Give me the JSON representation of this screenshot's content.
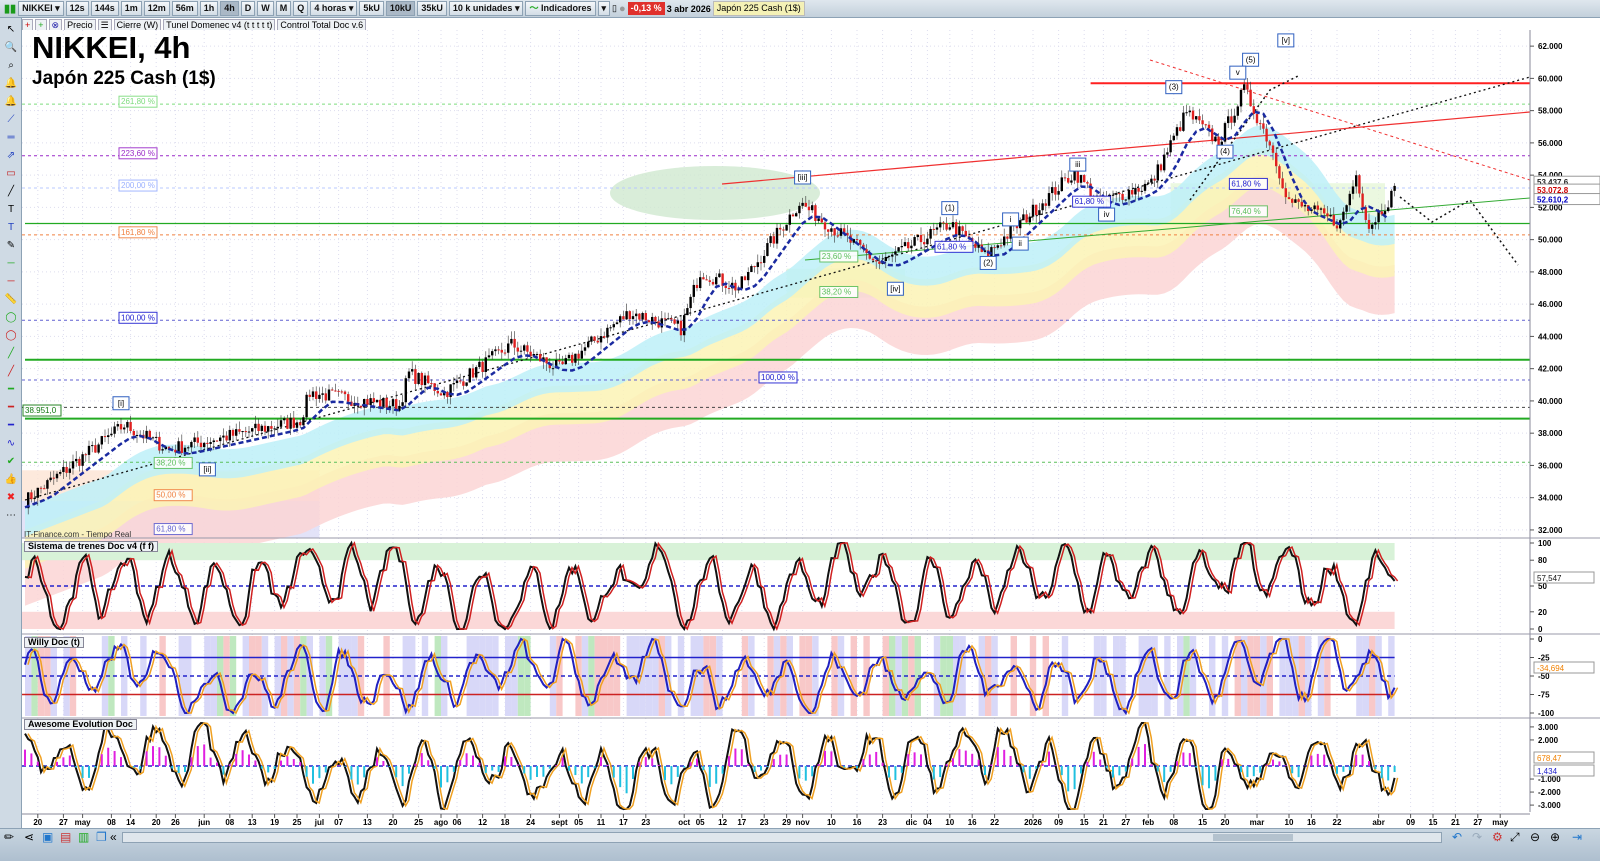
{
  "toolbar": {
    "symbol": "NIKKEI",
    "intervals": [
      "12s",
      "144s",
      "1m",
      "12m",
      "56m",
      "1h",
      "4h",
      "D",
      "W",
      "M",
      "Q"
    ],
    "active_interval": "4h",
    "period": "4 horas",
    "units": [
      "5kU",
      "10kU",
      "35kU"
    ],
    "active_unit": "10kU",
    "units_select": "10 k unidades",
    "indicators": "Indicadores",
    "change": "-0,13 %",
    "date": "3 abr 2026",
    "instrument": "Japón 225 Cash (1$)"
  },
  "legend": {
    "items": [
      "Precio",
      "Cierre (W)",
      "Tunel Domenec v4 (t t t t t)",
      "Control Total Doc v.6"
    ]
  },
  "chart": {
    "title": "NIKKEI, 4h",
    "subtitle": "Japón 225 Cash (1$)",
    "source": "IT-Finance.com - Tiempo Real"
  },
  "colors": {
    "up": "#1aa81a",
    "down": "#e02020",
    "fib_red": "#ff2020",
    "support_green": "#22aa22"
  },
  "chart_data": {
    "type": "candlestick",
    "price_anchors": [
      [
        0,
        33800
      ],
      [
        31,
        38500
      ],
      [
        45,
        37000
      ],
      [
        86,
        38800
      ],
      [
        89,
        40500
      ],
      [
        117,
        39700
      ],
      [
        120,
        41700
      ],
      [
        131,
        40500
      ],
      [
        152,
        43500
      ],
      [
        167,
        42000
      ],
      [
        189,
        45500
      ],
      [
        205,
        44500
      ],
      [
        211,
        48000
      ],
      [
        223,
        47000
      ],
      [
        242,
        52300
      ],
      [
        267,
        48500
      ],
      [
        289,
        51000
      ],
      [
        300,
        49000
      ],
      [
        328,
        54200
      ],
      [
        336,
        52300
      ],
      [
        352,
        53500
      ],
      [
        363,
        57900
      ],
      [
        373,
        56000
      ],
      [
        381,
        59300
      ],
      [
        389,
        56000
      ],
      [
        395,
        52400
      ],
      [
        411,
        51000
      ],
      [
        416,
        54000
      ],
      [
        420,
        50800
      ],
      [
        428,
        53000
      ]
    ],
    "y_ticks": [
      "62.000",
      "60.000",
      "58.000",
      "56.000",
      "54.000",
      "52.000",
      "50.000",
      "48.000",
      "46.000",
      "44.000",
      "42.000",
      "40.000",
      "38.000",
      "36.000",
      "34.000",
      "32.000"
    ],
    "y_tick_values": [
      62000,
      60000,
      58000,
      56000,
      54000,
      52000,
      50000,
      48000,
      46000,
      44000,
      42000,
      40000,
      38000,
      36000,
      34000,
      32000
    ],
    "ylim": [
      31500,
      63000
    ],
    "price_labels": [
      {
        "text": "53.437,6",
        "value": 53437,
        "color": "#222"
      },
      {
        "text": "53.072,8",
        "value": 53072,
        "color": "#c00"
      },
      {
        "text": "52.610,2",
        "value": 52610,
        "color": "#0000c0"
      }
    ],
    "x_ticks": [
      {
        "t": 4,
        "l": "20"
      },
      {
        "t": 12,
        "l": "27"
      },
      {
        "t": 18,
        "l": "may"
      },
      {
        "t": 27,
        "l": "08"
      },
      {
        "t": 33,
        "l": "14"
      },
      {
        "t": 41,
        "l": "20"
      },
      {
        "t": 47,
        "l": "26"
      },
      {
        "t": 56,
        "l": "jun"
      },
      {
        "t": 64,
        "l": "08"
      },
      {
        "t": 71,
        "l": "13"
      },
      {
        "t": 78,
        "l": "19"
      },
      {
        "t": 85,
        "l": "25"
      },
      {
        "t": 92,
        "l": "jul"
      },
      {
        "t": 98,
        "l": "07"
      },
      {
        "t": 107,
        "l": "13"
      },
      {
        "t": 115,
        "l": "20"
      },
      {
        "t": 123,
        "l": "25"
      },
      {
        "t": 130,
        "l": "ago"
      },
      {
        "t": 135,
        "l": "06"
      },
      {
        "t": 143,
        "l": "12"
      },
      {
        "t": 150,
        "l": "18"
      },
      {
        "t": 158,
        "l": "24"
      },
      {
        "t": 167,
        "l": "sept"
      },
      {
        "t": 173,
        "l": "05"
      },
      {
        "t": 180,
        "l": "11"
      },
      {
        "t": 187,
        "l": "17"
      },
      {
        "t": 194,
        "l": "23"
      },
      {
        "t": 206,
        "l": "oct"
      },
      {
        "t": 211,
        "l": "05"
      },
      {
        "t": 218,
        "l": "12"
      },
      {
        "t": 224,
        "l": "17"
      },
      {
        "t": 231,
        "l": "23"
      },
      {
        "t": 238,
        "l": "29"
      },
      {
        "t": 243,
        "l": "nov"
      },
      {
        "t": 252,
        "l": "10"
      },
      {
        "t": 260,
        "l": "16"
      },
      {
        "t": 268,
        "l": "23"
      },
      {
        "t": 277,
        "l": "dic"
      },
      {
        "t": 282,
        "l": "04"
      },
      {
        "t": 289,
        "l": "10"
      },
      {
        "t": 296,
        "l": "16"
      },
      {
        "t": 303,
        "l": "22"
      },
      {
        "t": 315,
        "l": "2026"
      },
      {
        "t": 323,
        "l": "09"
      },
      {
        "t": 331,
        "l": "15"
      },
      {
        "t": 337,
        "l": "21"
      },
      {
        "t": 344,
        "l": "27"
      },
      {
        "t": 351,
        "l": "feb"
      },
      {
        "t": 359,
        "l": "08"
      },
      {
        "t": 368,
        "l": "15"
      },
      {
        "t": 375,
        "l": "20"
      },
      {
        "t": 385,
        "l": "mar"
      },
      {
        "t": 395,
        "l": "10"
      },
      {
        "t": 402,
        "l": "16"
      },
      {
        "t": 410,
        "l": "22"
      },
      {
        "t": 423,
        "l": "abr"
      },
      {
        "t": 433,
        "l": "09"
      },
      {
        "t": 440,
        "l": "15"
      },
      {
        "t": 447,
        "l": "21"
      },
      {
        "t": 454,
        "l": "27"
      },
      {
        "t": 461,
        "l": "may"
      }
    ],
    "levels": [
      {
        "value": 59700,
        "color": "#ff2020",
        "from_t": 333
      },
      {
        "value": 42550,
        "color": "#22aa22",
        "from_t": 0
      },
      {
        "value": 38900,
        "color": "#22aa22",
        "from_t": 0
      },
      {
        "value": 51000,
        "color": "#22aa22",
        "from_t": 0
      }
    ],
    "fib_labels": [
      {
        "text": "261,80 %",
        "value": 58400,
        "t": 30,
        "color": "#7ddc7d"
      },
      {
        "text": "223,60 %",
        "value": 55200,
        "t": 30,
        "color": "#9a2ac8"
      },
      {
        "text": "200,00 %",
        "value": 53200,
        "t": 30,
        "color": "#9ab0ff"
      },
      {
        "text": "161,80 %",
        "value": 50300,
        "t": 30,
        "color": "#f08040"
      },
      {
        "text": "100,00 %",
        "value": 45000,
        "t": 30,
        "color": "#2020d0"
      },
      {
        "text": "100,00 %",
        "value": 41300,
        "t": 230,
        "color": "#2020d0"
      },
      {
        "text": "38.951,0",
        "value": 39250,
        "t": 0,
        "color": "#117711"
      },
      {
        "text": "38,20 %",
        "value": 36000,
        "t": 41,
        "color": "#5cbf5c"
      },
      {
        "text": "50,00 %",
        "value": 34000,
        "t": 41,
        "color": "#f08040"
      },
      {
        "text": "61,80 %",
        "value": 31900,
        "t": 41,
        "color": "#6060d0"
      },
      {
        "text": "38,20 %",
        "value": 46600,
        "t": 249,
        "color": "#5cbf5c"
      },
      {
        "text": "23,60 %",
        "value": 48800,
        "t": 249,
        "color": "#5cbf5c"
      },
      {
        "text": "61,80 %",
        "value": 49400,
        "t": 285,
        "color": "#2020d0"
      },
      {
        "text": "61,80 %",
        "value": 52200,
        "t": 328,
        "color": "#2020d0"
      },
      {
        "text": "61,80 %",
        "value": 53300,
        "t": 377,
        "color": "#2020d0"
      },
      {
        "text": "76,40 %",
        "value": 51600,
        "t": 377,
        "color": "#5cbf5c"
      }
    ],
    "wave_labels": [
      {
        "text": "[v]",
        "t": 394,
        "value": 62200
      },
      {
        "text": "(5)",
        "t": 383,
        "value": 61000
      },
      {
        "text": "v",
        "t": 379,
        "value": 60200
      },
      {
        "text": "(3)",
        "t": 359,
        "value": 59300
      },
      {
        "text": "(4)",
        "t": 375,
        "value": 55300
      },
      {
        "text": "iii",
        "t": 329,
        "value": 54500
      },
      {
        "text": "iv",
        "t": 338,
        "value": 51400
      },
      {
        "text": "[iii]",
        "t": 243,
        "value": 53700
      },
      {
        "text": "[iv]",
        "t": 272,
        "value": 46800
      },
      {
        "text": "[i]",
        "t": 30,
        "value": 39700
      },
      {
        "text": "[ii]",
        "t": 57,
        "value": 35600
      },
      {
        "text": "(1)",
        "t": 289,
        "value": 51800
      },
      {
        "text": "(2)",
        "t": 301,
        "value": 48400
      },
      {
        "text": "i",
        "t": 308,
        "value": 51100
      },
      {
        "text": "ii",
        "t": 311,
        "value": 49600
      }
    ],
    "panels": [
      {
        "title": "Sistema de trenes Doc v4 (f f)",
        "ticks": [
          "100",
          "80",
          "50",
          "20",
          "0"
        ],
        "tick_values": [
          100,
          80,
          50,
          20,
          0
        ],
        "range": [
          0,
          100
        ],
        "last": "57,547"
      },
      {
        "title": "Willy Doc (t)",
        "ticks": [
          "0",
          "-25",
          "-50",
          "-75",
          "-100"
        ],
        "tick_values": [
          0,
          -25,
          -50,
          -75,
          -100
        ],
        "range": [
          -100,
          0
        ],
        "last": "-34,694"
      },
      {
        "title": "Awesome Evolution Doc",
        "ticks": [
          "3.000",
          "2.000",
          "-1.000",
          "-2.000",
          "-3.000"
        ],
        "tick_values": [
          3000,
          2000,
          -1000,
          -2000,
          -3000
        ],
        "range": [
          -3300,
          3300
        ],
        "last": "678,47",
        "last2": "1,434"
      }
    ]
  }
}
